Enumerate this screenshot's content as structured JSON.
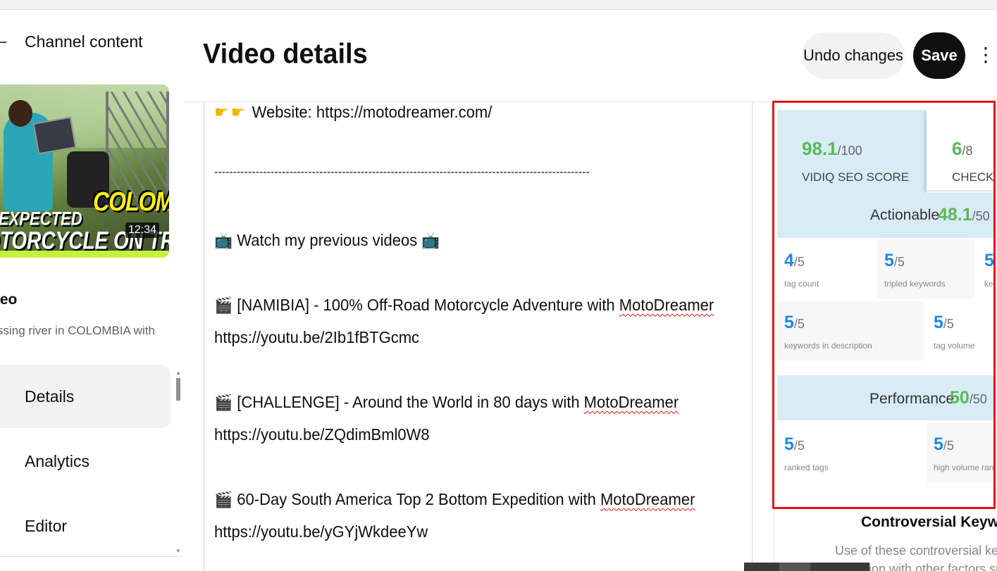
{
  "sidebar": {
    "back_label": "Channel content",
    "thumbnail": {
      "text_country": "COLOMBIA",
      "text_line1": "EXPECTED",
      "text_line2": "OTORCYCLE ON TRAIN CART",
      "duration": "12:34"
    },
    "video_label": "leo",
    "video_subtitle": "ssing river in COLOMBIA with B...",
    "nav": [
      {
        "label": "Details",
        "active": true
      },
      {
        "label": "Analytics",
        "active": false
      },
      {
        "label": "Editor",
        "active": false
      }
    ]
  },
  "header": {
    "title": "Video details",
    "undo_label": "Undo changes",
    "save_label": "Save",
    "more_icon": "⋮"
  },
  "description": {
    "website_line": "Website: https://motodreamer.com/",
    "divider": "----------------------------------------------------------------------------------------------------",
    "previous_heading": "Watch my previous videos",
    "videos": [
      {
        "prefix": "[NAMIBIA] - 100% Off-Road Motorcycle Adventure with ",
        "brand": "MotoDreamer",
        "url": "https://youtu.be/2Ib1fBTGcmc"
      },
      {
        "prefix": "[CHALLENGE] - Around the World in 80 days with ",
        "brand": "MotoDreamer",
        "url": "https://youtu.be/ZQdimBml0W8"
      },
      {
        "prefix": "60-Day South America Top 2 Bottom Expedition with ",
        "brand": "MotoDreamer",
        "url": "https://youtu.be/yGYjWkdeeYw"
      }
    ]
  },
  "vidiq": {
    "seo_score": "98.1",
    "seo_score_max": "/100",
    "seo_label": "VIDIQ SEO SCORE",
    "checklist_score": "6",
    "checklist_max": "/8",
    "checklist_label": "CHECKLI",
    "actionable": {
      "title": "Actionable",
      "score": "48.1",
      "max": "/50"
    },
    "actionable_metrics": [
      {
        "value": "4",
        "max": "/5",
        "label": "tag count"
      },
      {
        "value": "5",
        "max": "/5",
        "label": "tripled keywords"
      },
      {
        "value": "5",
        "max": "/",
        "label": "key"
      },
      {
        "value": "5",
        "max": "/5",
        "label": "keywords in description"
      },
      {
        "value": "5",
        "max": "/5",
        "label": "tag volume"
      }
    ],
    "performance": {
      "title": "Performance",
      "score": "50",
      "max": "/50"
    },
    "performance_metrics": [
      {
        "value": "5",
        "max": "/5",
        "label": "ranked tags"
      },
      {
        "value": "5",
        "max": "/5",
        "label": "high volume ranked"
      }
    ],
    "colors": {
      "score_green": "#5cb85c",
      "metric_blue": "#1e88e5",
      "highlight_border": "#e0101c",
      "panel_blue": "#d9ecf6"
    }
  },
  "controversial": {
    "title": "Controversial Keywords",
    "text1": "Use of these controversial keywords",
    "text2": "ion with other factors such a"
  }
}
